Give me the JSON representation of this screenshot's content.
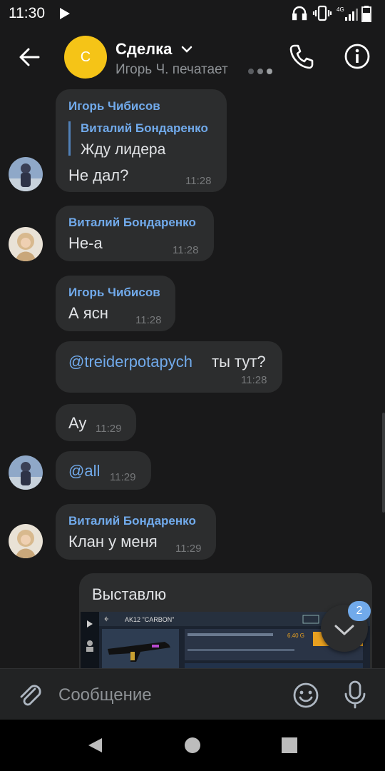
{
  "status_bar": {
    "time": "11:30",
    "network": "4G"
  },
  "header": {
    "avatar_letter": "С",
    "title": "Сделка",
    "subtitle": "Игорь Ч. печатает"
  },
  "messages": [
    {
      "sender": "Игорь Чибисов",
      "reply_to_sender": "Виталий Бондаренко",
      "reply_to_text": "Жду лидера",
      "text": "Не дал?",
      "time": "11:28"
    },
    {
      "sender": "Виталий Бондаренко",
      "text": "Не-а",
      "time": "11:28"
    },
    {
      "sender": "Игорь Чибисов",
      "text": "А ясн",
      "time": "11:28"
    },
    {
      "mention": "@treiderpotapych",
      "text": "ты тут?",
      "time": "11:28"
    },
    {
      "text": "Ау",
      "time": "11:29"
    },
    {
      "mention": "@all",
      "time": "11:29"
    },
    {
      "sender": "Виталий Бондаренко",
      "text": "Клан у меня",
      "time": "11:29"
    },
    {
      "text": "Выставлю",
      "image": {
        "item_title": "AK12 \"CARBON\"",
        "price": "6.40 G"
      }
    }
  ],
  "unread_badge": "2",
  "composer": {
    "placeholder": "Сообщение"
  },
  "colors": {
    "background": "#19191a",
    "bubble": "#2c2d2e",
    "accent": "#71aaeb",
    "avatar_chat": "#f5c417"
  }
}
